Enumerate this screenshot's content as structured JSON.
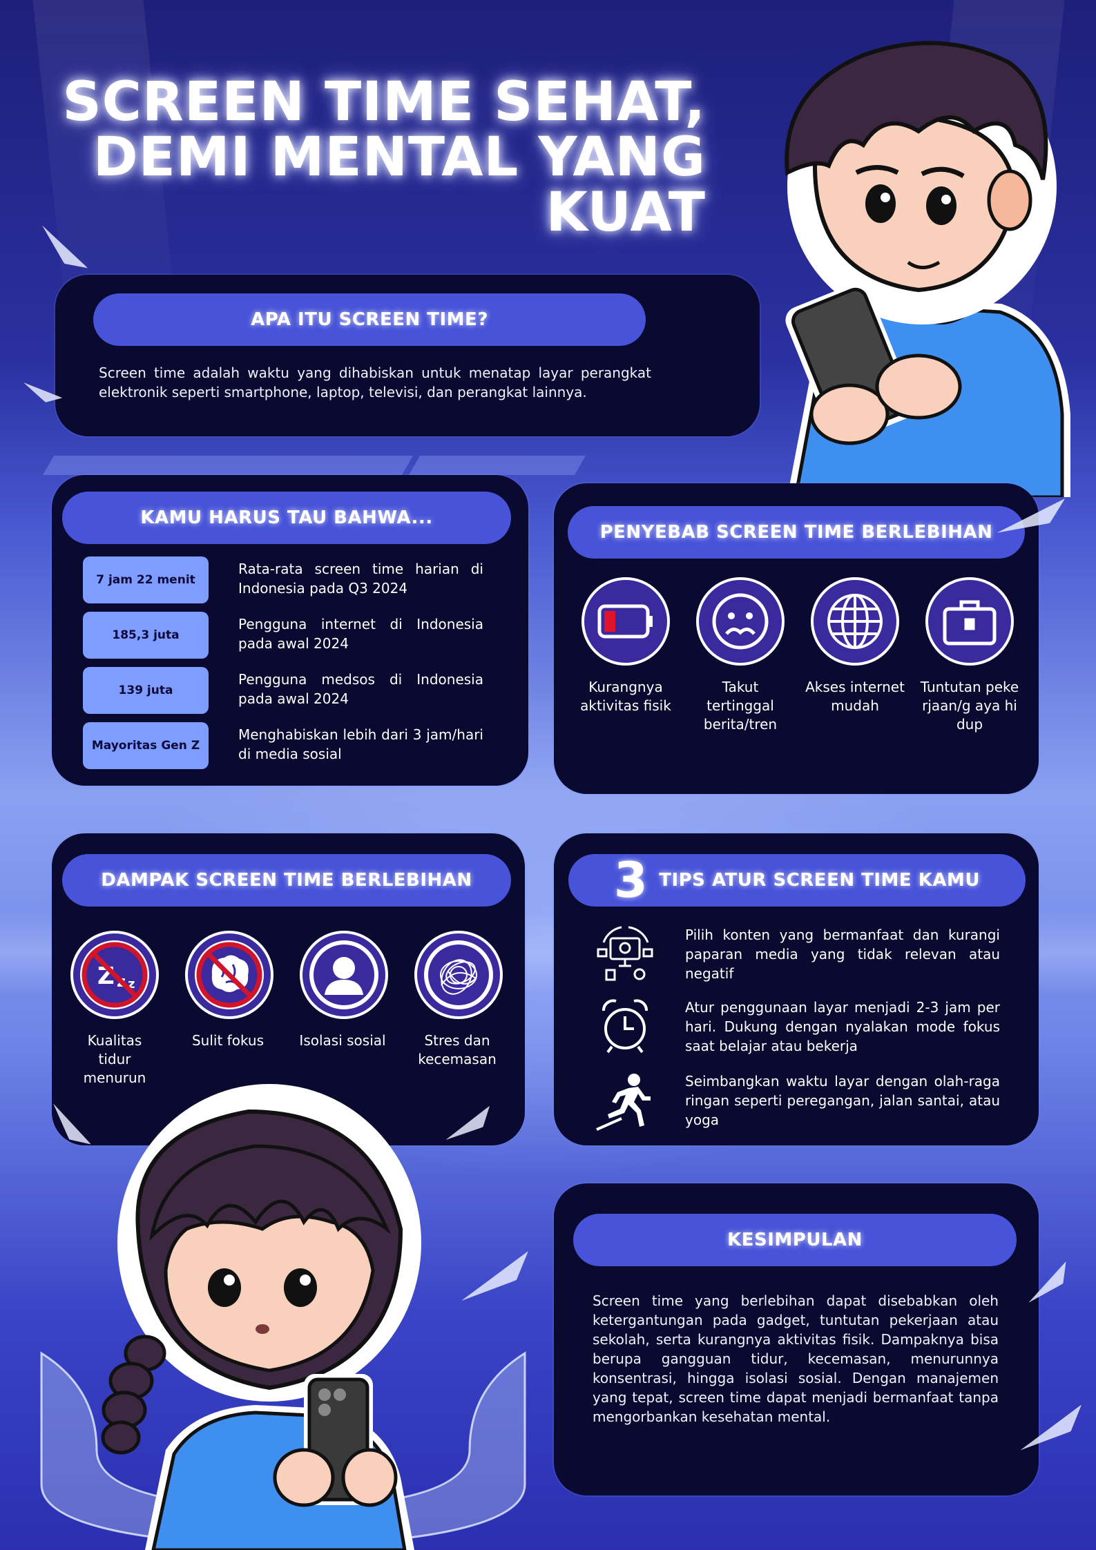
{
  "title_lines": [
    "SCREEN TIME SEHAT,",
    "DEMI MENTAL YANG",
    "KUAT"
  ],
  "what": {
    "heading": "APA ITU SCREEN TIME?",
    "text": "Screen time adalah waktu yang dihabiskan untuk menatap layar perangkat elektronik seperti smartphone, laptop, televisi, dan perangkat lainnya."
  },
  "facts": {
    "heading": "KAMU HARUS TAU BAHWA...",
    "items": [
      {
        "value": "7 jam 22 menit",
        "text": "Rata-rata screen time harian di Indonesia pada Q3 2024"
      },
      {
        "value": "185,3 juta",
        "text": "Pengguna internet di Indonesia pada awal 2024"
      },
      {
        "value": "139 juta",
        "text": "Pengguna medsos di Indonesia pada awal 2024"
      },
      {
        "value": "Mayoritas Gen Z",
        "text": "Menghabiskan lebih dari 3 jam/hari di media sosial"
      }
    ]
  },
  "causes": {
    "heading": "PENYEBAB SCREEN TIME BERLEBIHAN",
    "items": [
      {
        "label": "Kurangnya aktivitas fisik",
        "icon": "low-battery-icon"
      },
      {
        "label": "Takut tertinggal berita/tren",
        "icon": "worried-face-icon"
      },
      {
        "label": "Akses internet mudah",
        "icon": "globe-icon"
      },
      {
        "label": "Tuntutan pekerjaan/g aya hidup",
        "icon": "briefcase-icon"
      }
    ]
  },
  "impacts": {
    "heading": "DAMPAK SCREEN TIME BERLEBIHAN",
    "items": [
      {
        "label": "Kualitas tidur menurun",
        "icon": "no-sleep-icon"
      },
      {
        "label": "Sulit fokus",
        "icon": "no-brain-icon"
      },
      {
        "label": "Isolasi sosial",
        "icon": "person-icon"
      },
      {
        "label": "Stres dan kecemasan",
        "icon": "tangle-icon"
      }
    ]
  },
  "tips": {
    "number": "3",
    "heading": "TIPS ATUR SCREEN TIME KAMU",
    "items": [
      {
        "text": "Pilih konten yang bermanfaat dan kurangi paparan media yang tidak relevan atau negatif",
        "icon": "content-settings-icon"
      },
      {
        "text": "Atur penggunaan layar menjadi 2-3 jam per hari. Dukung dengan nyalakan mode fokus saat belajar atau bekerja",
        "icon": "alarm-clock-icon"
      },
      {
        "text": "Seimbangkan waktu layar dengan olah-raga ringan seperti peregangan, jalan santai, atau yoga",
        "icon": "running-icon"
      }
    ]
  },
  "conclusion": {
    "heading": "KESIMPULAN",
    "text": "Screen time yang berlebihan dapat disebabkan oleh ketergantungan pada gadget, tuntutan pekerjaan atau sekolah, serta kurangnya aktivitas fisik. Dampaknya bisa berupa gangguan tidur, kecemasan, menurunnya konsentrasi, hingga isolasi sosial. Dengan manajemen yang tepat, screen time dapat menjadi bermanfaat tanpa mengorbankan kesehatan mental."
  },
  "colors": {
    "panel": "#0a0930",
    "pill": "#4753d8",
    "fact_box": "#7f9cff",
    "warning_red": "#d0142c"
  }
}
